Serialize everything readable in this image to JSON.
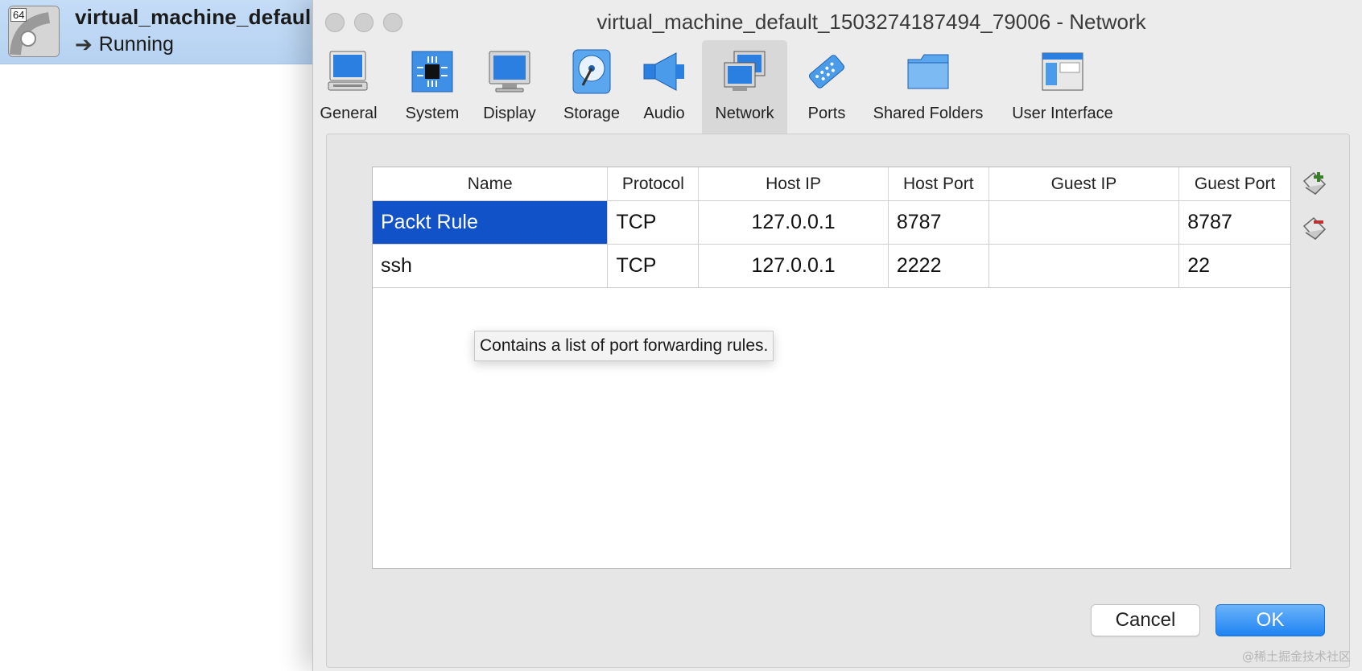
{
  "background": {
    "vm": {
      "os_badge": "64",
      "name": "virtual_machine_defaul",
      "state": "Running",
      "state_icon": "arrow-right-icon"
    }
  },
  "window": {
    "title": "virtual_machine_default_1503274187494_79006 - Network"
  },
  "toolbar": {
    "items": [
      {
        "label": "General",
        "icon": "general-icon"
      },
      {
        "label": "System",
        "icon": "chip-icon"
      },
      {
        "label": "Display",
        "icon": "monitor-icon"
      },
      {
        "label": "Storage",
        "icon": "disk-icon"
      },
      {
        "label": "Audio",
        "icon": "speaker-icon"
      },
      {
        "label": "Network",
        "icon": "network-icon",
        "selected": true
      },
      {
        "label": "Ports",
        "icon": "serial-port-icon"
      },
      {
        "label": "Shared Folders",
        "icon": "folder-icon"
      },
      {
        "label": "User Interface",
        "icon": "window-icon"
      }
    ]
  },
  "port_forwarding": {
    "columns": [
      "Name",
      "Protocol",
      "Host IP",
      "Host Port",
      "Guest IP",
      "Guest Port"
    ],
    "rows": [
      {
        "name": "Packt Rule",
        "protocol": "TCP",
        "host_ip": "127.0.0.1",
        "host_port": "8787",
        "guest_ip": "",
        "guest_port": "8787",
        "selected": true
      },
      {
        "name": "ssh",
        "protocol": "TCP",
        "host_ip": "127.0.0.1",
        "host_port": "2222",
        "guest_ip": "",
        "guest_port": "22",
        "selected": false
      }
    ],
    "tooltip": "Contains a list of port forwarding rules."
  },
  "buttons": {
    "cancel": "Cancel",
    "ok": "OK"
  },
  "watermark": "@稀土掘金技术社区",
  "colors": {
    "selection": "#1252c8",
    "ok_button": "#1e83f2",
    "vm_selected_row": "#b6d2f1"
  }
}
